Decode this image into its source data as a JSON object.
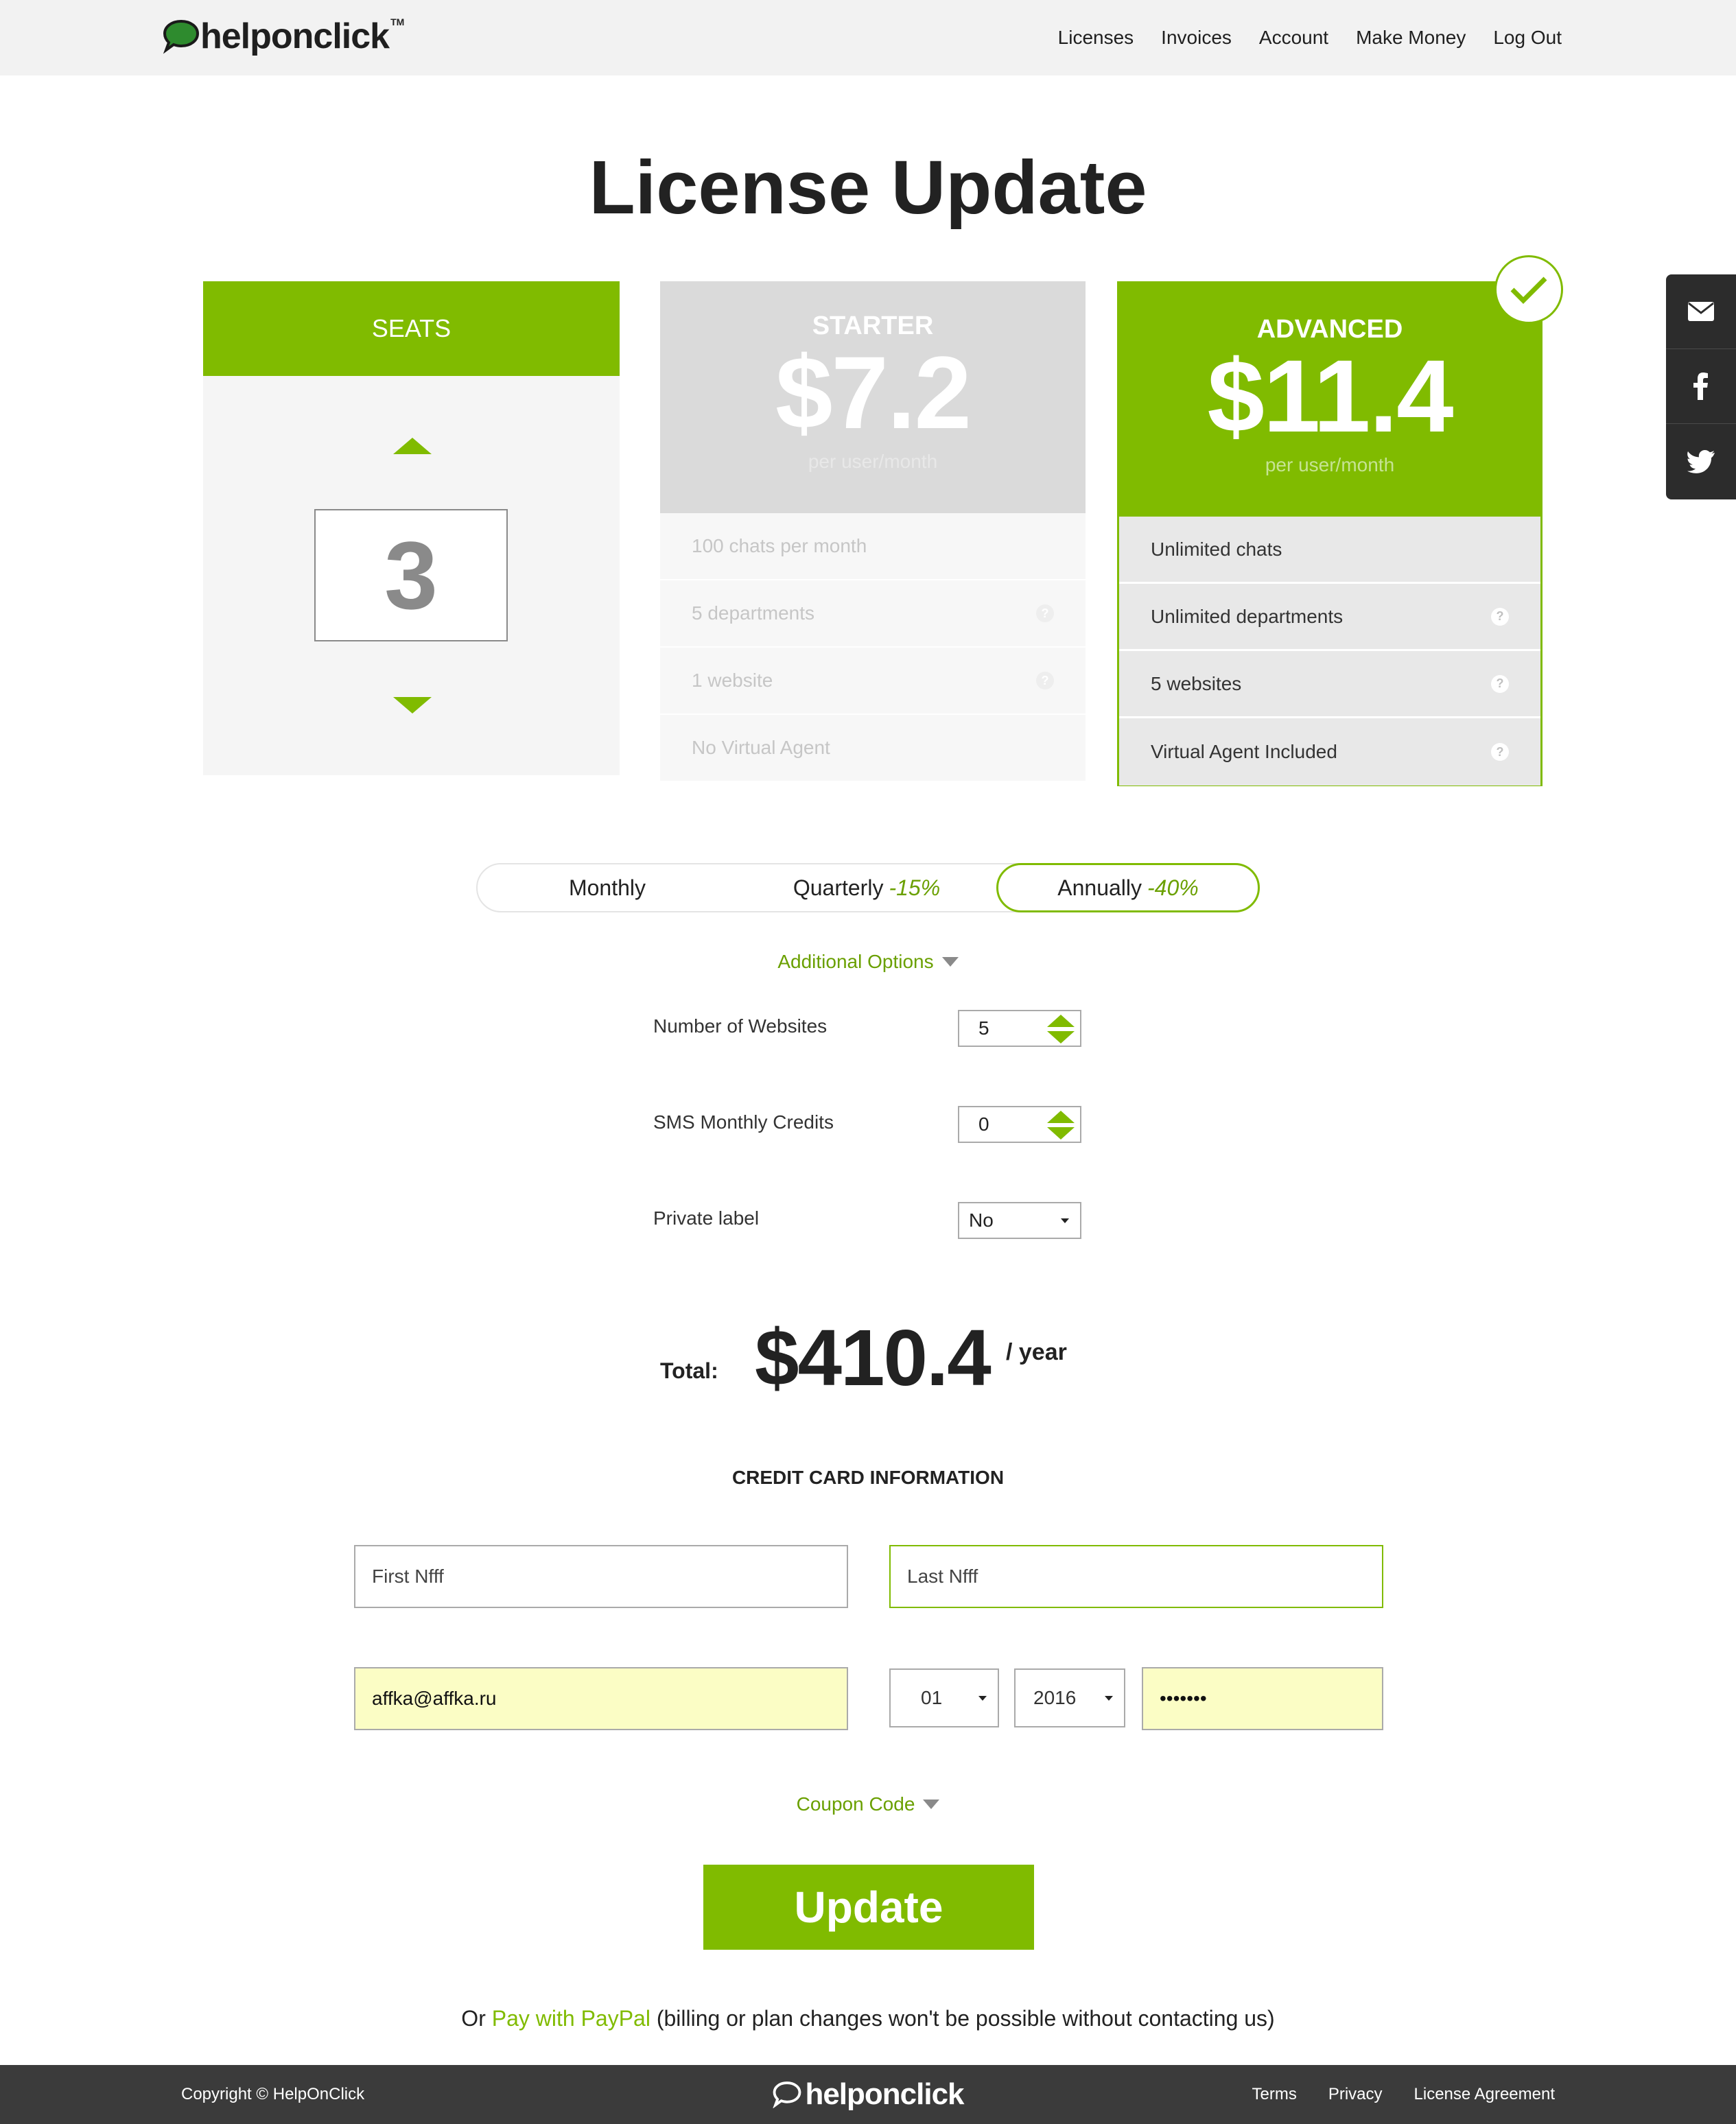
{
  "header": {
    "logo_text": "helponclick",
    "logo_tm": "TM",
    "nav": [
      "Licenses",
      "Invoices",
      "Account",
      "Make Money",
      "Log Out"
    ]
  },
  "share": {
    "icons": [
      "envelope-icon",
      "facebook-icon",
      "twitter-icon"
    ]
  },
  "page_title": "License Update",
  "seats": {
    "label": "SEATS",
    "value": "3"
  },
  "plans": {
    "starter": {
      "name": "STARTER",
      "price": "$7.2",
      "unit": "per user/month",
      "features": [
        "100 chats per month",
        "5 departments",
        "1 website",
        "No Virtual Agent"
      ]
    },
    "advanced": {
      "name": "ADVANCED",
      "price": "$11.4",
      "unit": "per user/month",
      "features": [
        "Unlimited chats",
        "Unlimited departments",
        "5 websites",
        "Virtual Agent Included"
      ]
    }
  },
  "billing": {
    "monthly": "Monthly",
    "quarterly": "Quarterly",
    "quarterly_discount": "-15%",
    "annually": "Annually",
    "annually_discount": "-40%",
    "selected": "Annually"
  },
  "additional_options": {
    "toggle_label": "Additional Options",
    "websites_label": "Number of Websites",
    "websites_value": "5",
    "sms_label": "SMS Monthly Credits",
    "sms_value": "0",
    "private_label": "Private label",
    "private_value": "No"
  },
  "total": {
    "label": "Total:",
    "amount": "$410.4",
    "unit": "/ year"
  },
  "credit_card": {
    "title": "CREDIT CARD INFORMATION",
    "first_name": "First Nfff",
    "last_name": "Last Nfff",
    "email": "affka@affka.ru",
    "month": "01",
    "year": "2016",
    "card_masked": "•••••••"
  },
  "coupon_label": "Coupon Code",
  "update_label": "Update",
  "paypal": {
    "prefix": "Or",
    "link": "Pay with PayPal",
    "suffix": "(billing or plan changes won't be possible without contacting us)"
  },
  "footer": {
    "copyright": "Copyright © HelpOnClick",
    "logo": "helponclick",
    "links": [
      "Terms",
      "Privacy",
      "License Agreement"
    ]
  },
  "colors": {
    "accent": "#80bb00",
    "footer": "#3b3b3b",
    "autofill": "#fbfdc5"
  }
}
